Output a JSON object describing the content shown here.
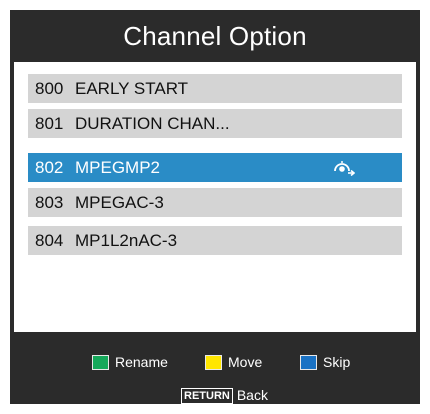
{
  "title": "Channel Option",
  "channels": [
    {
      "number": "800",
      "name": "EARLY START"
    },
    {
      "number": "801",
      "name": "DURATION CHAN..."
    },
    {
      "number": "802",
      "name": "MPEGMP2",
      "icon": "skip-icon"
    },
    {
      "number": "803",
      "name": "MPEGAC-3"
    },
    {
      "number": "804",
      "name": "MP1L2nAC-3"
    }
  ],
  "selected_index": 2,
  "legend": {
    "rename": {
      "label": "Rename",
      "color": "#15a85a"
    },
    "move": {
      "label": "Move",
      "color": "#ffe600"
    },
    "skip": {
      "label": "Skip",
      "color": "#1a72c4"
    }
  },
  "back": {
    "key": "RETURN",
    "label": "Back"
  },
  "colors": {
    "osd_background": "#2b2b2b",
    "row_background": "#d4d4d4",
    "selected_row": "#2a8cc6"
  }
}
